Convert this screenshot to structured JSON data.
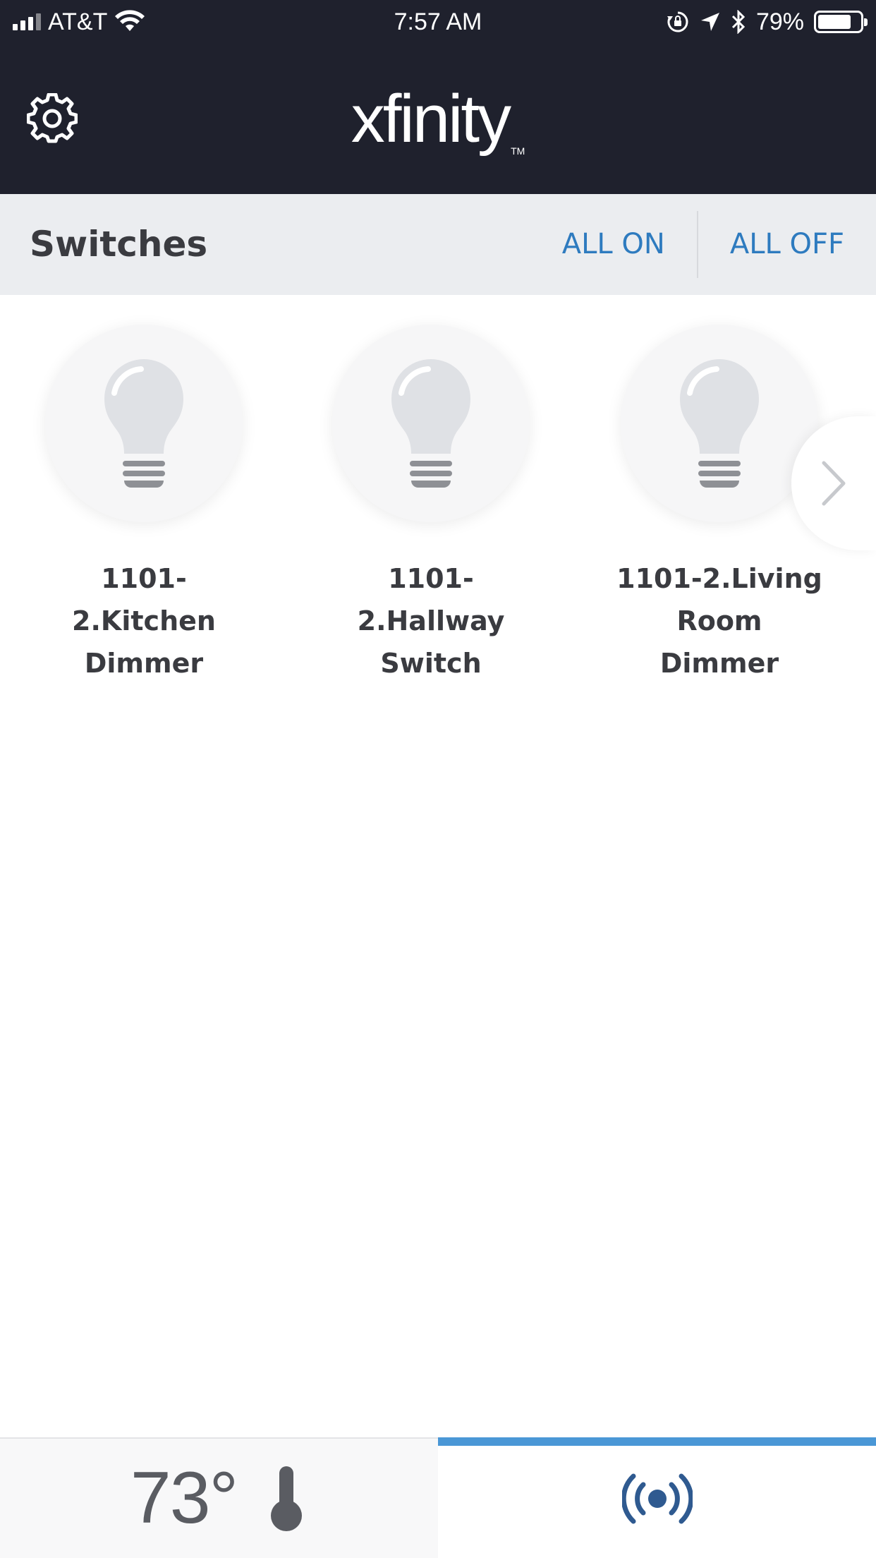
{
  "status_bar": {
    "carrier": "AT&T",
    "time": "7:57 AM",
    "battery": "79%",
    "battery_level": 0.79
  },
  "header": {
    "logo_text": "xfinity",
    "logo_tm": "TM",
    "icons": [
      "gear-icon"
    ]
  },
  "section": {
    "title": "Switches",
    "all_on": "ALL ON",
    "all_off": "ALL OFF"
  },
  "switches": [
    {
      "line1": "1101-2.Kitchen",
      "line2": "Dimmer",
      "state": "off"
    },
    {
      "line1": "1101-2.Hallway",
      "line2": "Switch",
      "state": "off"
    },
    {
      "line1": "1101-2.Living",
      "line2": "Room Dimmer",
      "state": "off"
    }
  ],
  "bottom_bar": {
    "temperature": "73°",
    "active_tab": "security",
    "icons": [
      "thermometer-icon",
      "broadcast-icon"
    ]
  },
  "colors": {
    "header_bg": "#1f212d",
    "accent": "#2e7bbf",
    "tab_indicator": "#4a97d6",
    "bulb": "#dfe1e5",
    "bulb_base": "#8e9095"
  }
}
